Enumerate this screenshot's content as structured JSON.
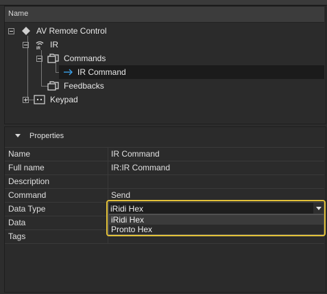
{
  "tree": {
    "header": "Name",
    "items": [
      {
        "label": "AV Remote Control",
        "icon": "diamond-icon"
      },
      {
        "label": "IR",
        "icon": "ir-signal-icon"
      },
      {
        "label": "Commands",
        "icon": "folder-icon"
      },
      {
        "label": "IR Command",
        "icon": "arrow-right-icon",
        "selected": true
      },
      {
        "label": "Feedbacks",
        "icon": "folder-icon"
      },
      {
        "label": "Keypad",
        "icon": "keypad-icon"
      }
    ]
  },
  "properties": {
    "title": "Properties",
    "rows": [
      {
        "label": "Name",
        "value": "IR Command"
      },
      {
        "label": "Full name",
        "value": "IR:IR Command"
      },
      {
        "label": "Description",
        "value": ""
      },
      {
        "label": "Command",
        "value": "Send"
      },
      {
        "label": "Data Type",
        "value": "iRidi Hex"
      },
      {
        "label": "Data",
        "value": ""
      },
      {
        "label": "Tags",
        "value": ""
      }
    ],
    "data_type_dropdown": {
      "selected": "iRidi Hex",
      "options": [
        "iRidi Hex",
        "Pronto Hex"
      ]
    }
  },
  "colors": {
    "highlight_border": "#e3c23a",
    "arrow_icon": "#3aa0e8"
  }
}
